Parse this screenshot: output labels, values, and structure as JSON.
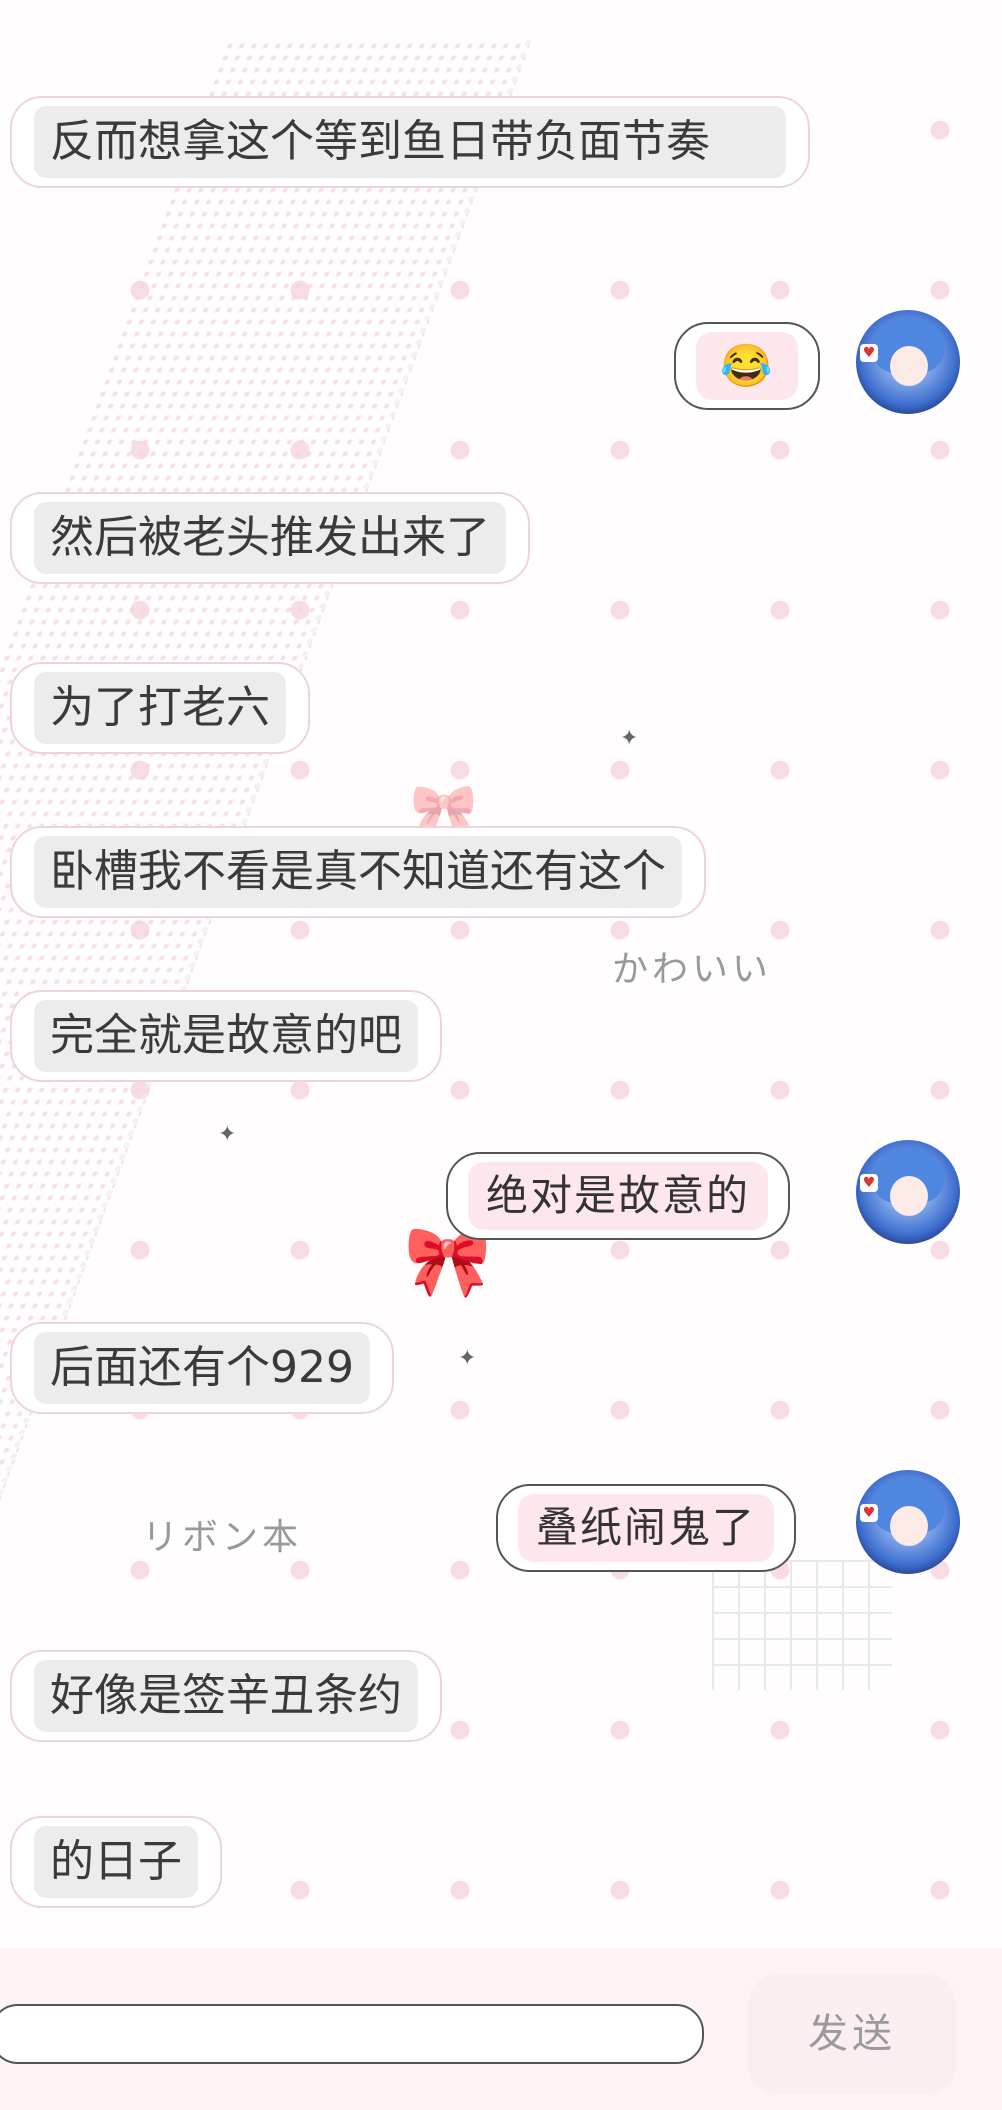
{
  "messages": [
    {
      "side": "left",
      "text": "反而想拿这个等到鱼日带负面节奏"
    },
    {
      "side": "right",
      "text": "😂",
      "emoji_name": "laughing-crying-emoji"
    },
    {
      "side": "left",
      "text": "然后被老头推发出来了"
    },
    {
      "side": "left",
      "text": "为了打老六"
    },
    {
      "side": "left",
      "text": "卧槽我不看是真不知道还有这个"
    },
    {
      "side": "left",
      "text": "完全就是故意的吧"
    },
    {
      "side": "right",
      "text": "绝对是故意的"
    },
    {
      "side": "left",
      "text": "后面还有个929"
    },
    {
      "side": "right",
      "text": "叠纸闹鬼了"
    },
    {
      "side": "left",
      "text": "好像是签辛丑条约"
    },
    {
      "side": "left",
      "text": "的日子"
    }
  ],
  "decorations": {
    "kawaii": "かわいい",
    "ribbon": "リボン本"
  },
  "composer": {
    "input_value": "",
    "send_label": "发送"
  },
  "colors": {
    "bubble_left_fill": "#ececec",
    "bubble_right_fill": "#fde7ec",
    "polka_dot": "#f7dde3",
    "bottom_bar": "#fdf3f4"
  }
}
